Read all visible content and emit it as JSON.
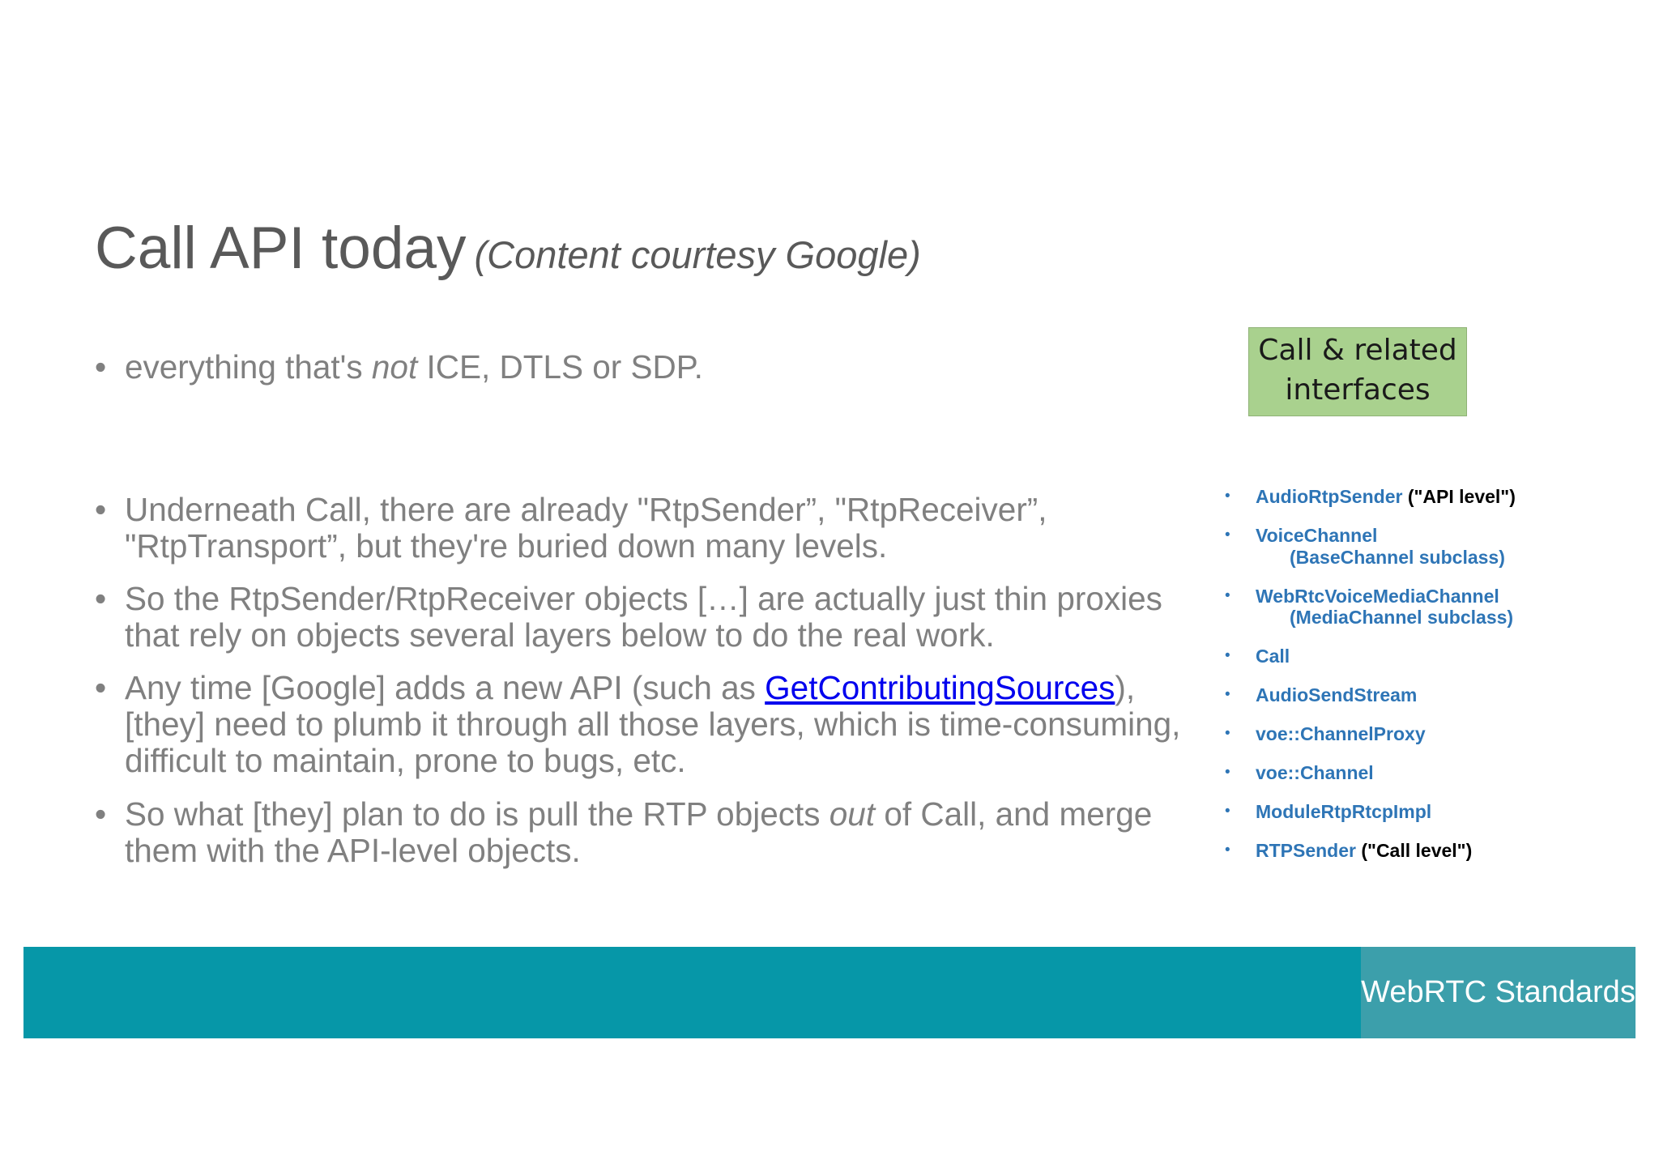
{
  "slide": {
    "title": "Call API today",
    "subtitle": "(Content courtesy Google)",
    "bullets": {
      "b1": {
        "pre": "everything that's ",
        "em": "not",
        "post": " ICE, DTLS or SDP."
      },
      "b2": {
        "line1": "Underneath Call, there are already \"RtpSender”, \"RtpReceiver”,",
        "line2": "\"RtpTransport”, but they're buried down many levels."
      },
      "b3": {
        "line1": "So the RtpSender/RtpReceiver objects […] are actually just thin proxies",
        "line2": "that rely on objects several layers below to do the real work."
      },
      "b4": {
        "pre": "Any time [Google] adds a new API (such as ",
        "link": "GetContributingSources",
        "post": "),",
        "line2": "[they] need to plumb it through all those layers, which is time-consuming,",
        "line3": "difficult to maintain, prone to bugs, etc."
      },
      "b5": {
        "pre": "So what [they] plan to do is pull the RTP objects ",
        "em": "out",
        "post": " of Call, and merge",
        "line2": "them with the API-level objects."
      }
    },
    "bullet_glyph": "•",
    "callbox": {
      "line1": "Call & related",
      "line2": "interfaces"
    },
    "interfaces": {
      "i1": {
        "name": "AudioRtpSender",
        "note": " (\"API level\")"
      },
      "i2": {
        "name": "VoiceChannel",
        "sub": "(BaseChannel subclass)"
      },
      "i3": {
        "name": "WebRtcVoiceMediaChannel",
        "sub": "(MediaChannel subclass)"
      },
      "i4": {
        "name": "Call"
      },
      "i5": {
        "name": "AudioSendStream"
      },
      "i6": {
        "name": "voe::ChannelProxy"
      },
      "i7": {
        "name": "voe::Channel"
      },
      "i8": {
        "name": "ModuleRtpRtcpImpl"
      },
      "i9": {
        "name": "RTPSender",
        "note": " (\"Call level\")"
      }
    },
    "footer": {
      "brand": "WebRTC Standards"
    },
    "colors": {
      "band": "#0697a8",
      "brand_box": "#3c9fab",
      "callbox": "#a9d18e",
      "interface_text": "#2e75b6",
      "body_text": "#808080"
    }
  }
}
